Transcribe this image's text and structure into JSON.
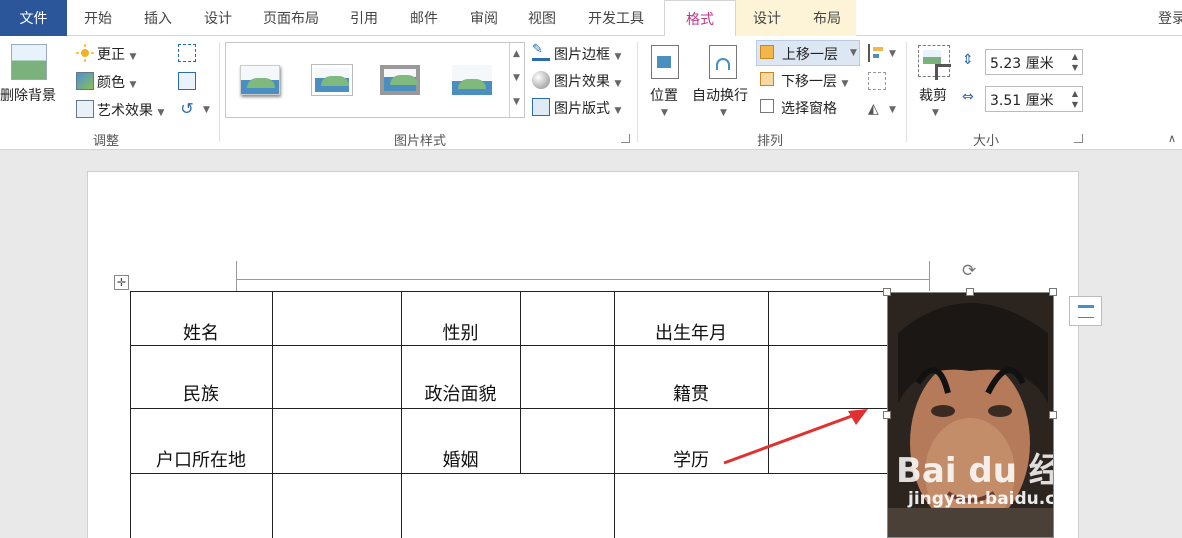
{
  "tabs": {
    "file": "文件",
    "home": "开始",
    "insert": "插入",
    "design": "设计",
    "layout": "页面布局",
    "references": "引用",
    "mailings": "邮件",
    "review": "审阅",
    "view": "视图",
    "developer": "开发工具",
    "format": "格式",
    "table_design": "设计",
    "table_layout": "布局",
    "login": "登录"
  },
  "adjust": {
    "remove_bg": "删除背景",
    "corrections": "更正",
    "color": "颜色",
    "artistic": "艺术效果",
    "group_label": "调整"
  },
  "picture_styles": {
    "border": "图片边框",
    "effects": "图片效果",
    "layout": "图片版式",
    "group_label": "图片样式"
  },
  "arrange": {
    "position": "位置",
    "wrap": "自动换行",
    "bring_forward": "上移一层",
    "send_backward": "下移一层",
    "selection_pane": "选择窗格",
    "group_label": "排列"
  },
  "size": {
    "crop": "裁剪",
    "height": "5.23 厘米",
    "width": "3.51 厘米",
    "group_label": "大小"
  },
  "table": {
    "rows": [
      [
        "姓名",
        "",
        "性别",
        "",
        "出生年月",
        ""
      ],
      [
        "民族",
        "",
        "政治面貌",
        "",
        "籍贯",
        ""
      ],
      [
        "户口所在地",
        "",
        "婚姻",
        "",
        "学历",
        ""
      ]
    ]
  },
  "watermark": {
    "brand": "Bai du 经验",
    "url": "jingyan.baidu.com"
  },
  "colors": {
    "file_tab": "#2b579a",
    "active_tab_text": "#c0368b",
    "context_tab_bg": "#fdf4d8",
    "arrow": "#e03030"
  }
}
